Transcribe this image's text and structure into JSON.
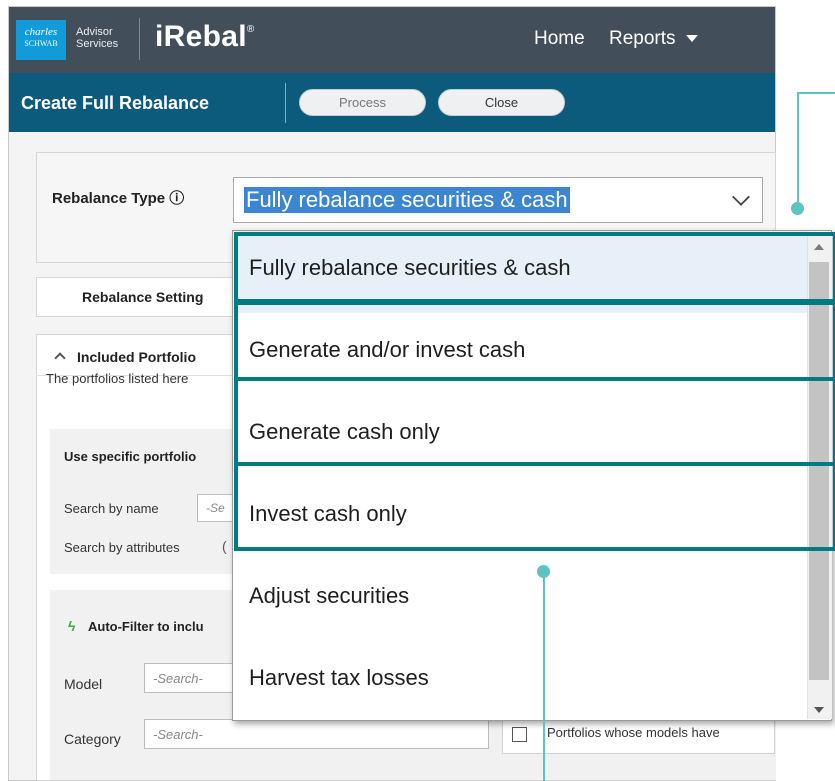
{
  "logo": {
    "line1": "charles",
    "line2": "SCHWAB"
  },
  "advisor": {
    "line1": "Advisor",
    "line2": "Services"
  },
  "brand": {
    "name": "iRebal",
    "mark": "®"
  },
  "nav": {
    "home": "Home",
    "reports": "Reports"
  },
  "subheader": {
    "title": "Create Full Rebalance",
    "process_label": "Process",
    "close_label": "Close"
  },
  "rebalance_type": {
    "label": "Rebalance Type ⓘ",
    "selected": "Fully rebalance securities & cash",
    "options": [
      "Fully rebalance securities & cash",
      "Generate and/or invest cash",
      "Generate cash only",
      "Invest cash only",
      "Adjust securities",
      "Harvest tax losses"
    ]
  },
  "settings": {
    "label": "Rebalance Setting"
  },
  "included": {
    "title": "Included Portfolio",
    "description": "The portfolios listed here",
    "specific_title": "Use specific portfolio",
    "search_by_name": "Search by name",
    "search_name_placeholder": "-Se",
    "search_by_attributes": "Search by attributes",
    "search_attr_paren": "("
  },
  "autofilter": {
    "title": "Auto-Filter to inclu",
    "model_label": "Model",
    "model_placeholder": "-Search-",
    "category_label": "Category",
    "category_placeholder": "-Search-",
    "checkbox_label": "Portfolios whose models have"
  },
  "colors": {
    "nav_bg": "#424f5b",
    "subbar_bg": "#0d5b7c",
    "highlight": "#007b82",
    "callout": "#5ec3c1",
    "selection": "#3c86d1"
  }
}
